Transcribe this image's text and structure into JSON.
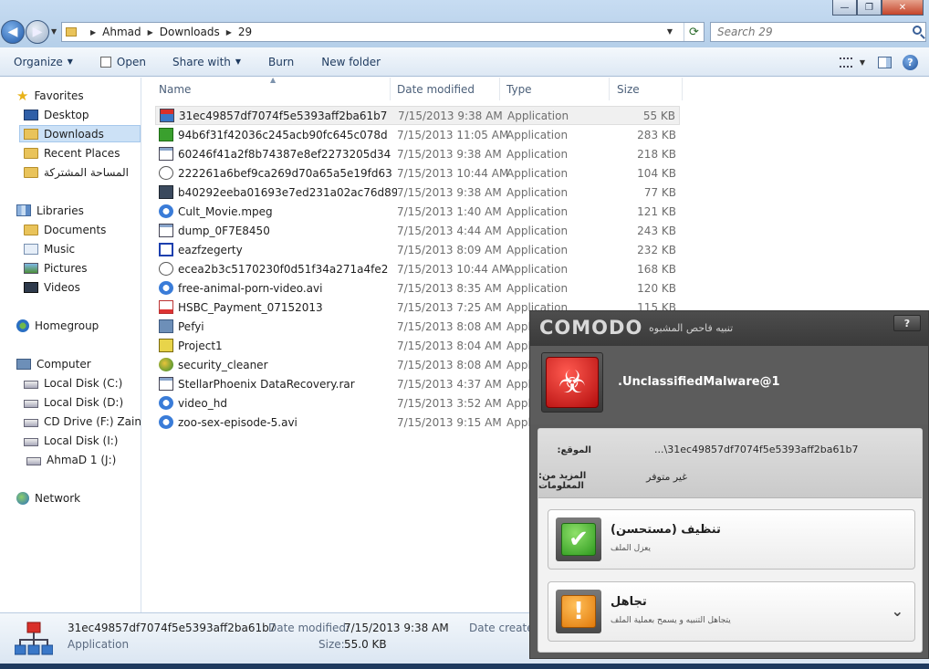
{
  "window": {
    "controls": {
      "minimize": "—",
      "maximize": "❐",
      "close": "✕"
    }
  },
  "address": {
    "crumbs": [
      "Ahmad",
      "Downloads",
      "29"
    ],
    "search_placeholder": "Search 29"
  },
  "toolbar": {
    "organize": "Organize",
    "open": "Open",
    "share_with": "Share with",
    "burn": "Burn",
    "new_folder": "New folder",
    "help": "?"
  },
  "nav": {
    "favorites": "Favorites",
    "desktop": "Desktop",
    "downloads": "Downloads",
    "recent_places": "Recent Places",
    "shared": "المساحة المشتركة",
    "libraries": "Libraries",
    "documents": "Documents",
    "music": "Music",
    "pictures": "Pictures",
    "videos": "Videos",
    "homegroup": "Homegroup",
    "computer": "Computer",
    "disk_c": "Local Disk (C:)",
    "disk_d": "Local Disk (D:)",
    "cd_drive": "CD Drive (F:) Zain Br",
    "disk_i": "Local Disk (I:)",
    "disk_j": "AhmaD 1 (J:)",
    "network": "Network"
  },
  "columns": {
    "name": "Name",
    "date": "Date modified",
    "type": "Type",
    "size": "Size"
  },
  "files": [
    {
      "name": "31ec49857df7074f5e5393aff2ba61b7",
      "date": "7/15/2013 9:38 AM",
      "type": "Application",
      "size": "55 KB",
      "icon": "network-app-icon"
    },
    {
      "name": "94b6f31f42036c245acb90fc645c078d",
      "date": "7/15/2013 11:05 AM",
      "type": "Application",
      "size": "283 KB",
      "icon": "green-app-icon"
    },
    {
      "name": "60246f41a2f8b74387e8ef2273205d34",
      "date": "7/15/2013 9:38 AM",
      "type": "Application",
      "size": "218 KB",
      "icon": "window-app-icon"
    },
    {
      "name": "222261a6bef9ca269d70a65a5e19fd63",
      "date": "7/15/2013 10:44 AM",
      "type": "Application",
      "size": "104 KB",
      "icon": "round-app-icon"
    },
    {
      "name": "b40292eeba01693e7ed231a02ac76d89",
      "date": "7/15/2013 9:38 AM",
      "type": "Application",
      "size": "77 KB",
      "icon": "dark-app-icon"
    },
    {
      "name": "Cult_Movie.mpeg",
      "date": "7/15/2013 1:40 AM",
      "type": "Application",
      "size": "121 KB",
      "icon": "ie-icon"
    },
    {
      "name": "dump_0F7E8450",
      "date": "7/15/2013 4:44 AM",
      "type": "Application",
      "size": "243 KB",
      "icon": "window-app-icon"
    },
    {
      "name": "eazfzegerty",
      "date": "7/15/2013 8:09 AM",
      "type": "Application",
      "size": "232 KB",
      "icon": "blue-frame-icon"
    },
    {
      "name": "ecea2b3c5170230f0d51f34a271a4fe2",
      "date": "7/15/2013 10:44 AM",
      "type": "Application",
      "size": "168 KB",
      "icon": "round-app-icon"
    },
    {
      "name": "free-animal-porn-video.avi",
      "date": "7/15/2013 8:35 AM",
      "type": "Application",
      "size": "120 KB",
      "icon": "ie-icon"
    },
    {
      "name": "HSBC_Payment_07152013",
      "date": "7/15/2013 7:25 AM",
      "type": "Application",
      "size": "115 KB",
      "icon": "pdf-icon"
    },
    {
      "name": "Pefyi",
      "date": "7/15/2013 8:08 AM",
      "type": "Application",
      "size": "",
      "icon": "computer-icon"
    },
    {
      "name": "Project1",
      "date": "7/15/2013 8:04 AM",
      "type": "Application",
      "size": "",
      "icon": "vb-icon"
    },
    {
      "name": "security_cleaner",
      "date": "7/15/2013 8:08 AM",
      "type": "Application",
      "size": "",
      "icon": "globe-icon"
    },
    {
      "name": "StellarPhoenix DataRecovery.rar",
      "date": "7/15/2013 4:37 AM",
      "type": "Application",
      "size": "",
      "icon": "window-app-icon"
    },
    {
      "name": "video_hd",
      "date": "7/15/2013 3:52 AM",
      "type": "Application",
      "size": "",
      "icon": "ie-icon"
    },
    {
      "name": "zoo-sex-episode-5.avi",
      "date": "7/15/2013 9:15 AM",
      "type": "Application",
      "size": "",
      "icon": "ie-icon"
    }
  ],
  "details": {
    "name": "31ec49857df7074f5e5393aff2ba61b7",
    "type": "Application",
    "date_label": "Date modified:",
    "date_value": "7/15/2013 9:38 AM",
    "size_label": "Size:",
    "size_value": "55.0 KB",
    "created_label": "Date created"
  },
  "comodo": {
    "logo": "COMODO",
    "title": "تنبيه فاحص المشبوه",
    "help": "?",
    "malware": ".UnclassifiedMalware@1",
    "location_label": ":الموقع",
    "location_value": "...\\31ec49857df7074f5e5393aff2ba61b7",
    "more_info_label": ":المزيد من المعلومات",
    "more_info_value": "غير متوفر",
    "clean_title": "تنظيف (مستحسن)",
    "clean_sub": "يعزل الملف",
    "ignore_title": "تجاهل",
    "ignore_sub": "يتجاهل التنبيه و يسمح بعملية الملف"
  }
}
